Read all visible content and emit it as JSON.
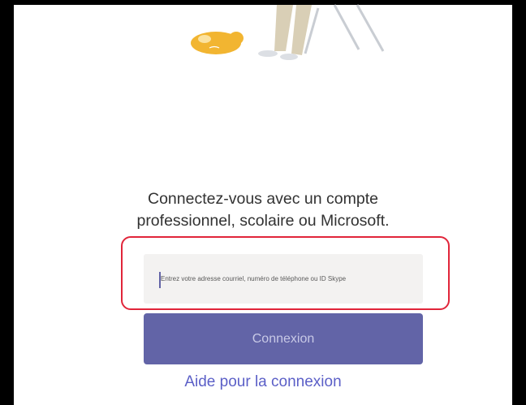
{
  "illustration": {
    "icons": [
      "sleeping-cat-icon",
      "person-legs-icon",
      "chair-icon"
    ],
    "colors": {
      "cat": "#f2b531",
      "pants": "#d9cfb6",
      "chair": "#c9cdd3"
    }
  },
  "signin": {
    "prompt_line1": "Connectez-vous avec un compte",
    "prompt_line2": "professionnel, scolaire ou Microsoft.",
    "email_placeholder": "Entrez votre adresse courriel, numéro de téléphone ou ID Skype",
    "email_value": "",
    "button_label": "Connexion",
    "help_link": "Aide pour la connexion"
  },
  "colors": {
    "accent": "#6264a7",
    "highlight": "#e1253a",
    "link": "#5b5fc7"
  }
}
